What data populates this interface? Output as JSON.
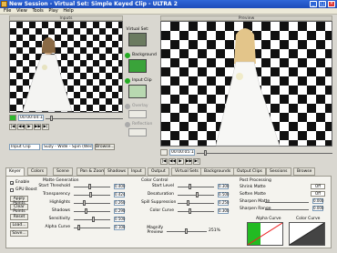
{
  "window": {
    "title": "New Session - Virtual Set: Simple Keyed Clip - ULTRA 2"
  },
  "menu": [
    "File",
    "View",
    "Tools",
    "Play",
    "Help"
  ],
  "input_panel": {
    "header": "Inputs",
    "timecode": "00:00:04:14",
    "source_select": "Input Clip",
    "clip_field": "Suzy - Wide - Spin (Wedding)...",
    "browse_label": "Browse..."
  },
  "virtual_set": {
    "header": "Virtual Set:",
    "items": [
      "Background",
      "Input Clip",
      "Overlay",
      "Reflection"
    ]
  },
  "preview_panel": {
    "header": "Preview",
    "timecode": "00:00:05:14"
  },
  "tabs": [
    "Keyer",
    "Colors",
    "Scene",
    "Pan & Zoom",
    "Shadows",
    "Input",
    "Output",
    "Virtual Sets",
    "Backgrounds",
    "Output Clips",
    "Sessions",
    "Browse"
  ],
  "keyer": {
    "enable_label": "Enable",
    "gpu_boost_label": "GPU Boost",
    "buttons": [
      "Apply Points",
      "Clear Points",
      "Reset",
      "Load...",
      "Save..."
    ],
    "matte_header": "Matte Generation",
    "matte": [
      {
        "label": "Start Threshold",
        "value": "0.400"
      },
      {
        "label": "Transparency",
        "value": "0.424"
      },
      {
        "label": "Highlights",
        "value": "0.260"
      },
      {
        "label": "Shadows",
        "value": "0.290"
      },
      {
        "label": "Sensitivity",
        "value": "0.500"
      },
      {
        "label": "Alpha Curve",
        "value": "0.100"
      }
    ],
    "color_header": "Color Control",
    "color": [
      {
        "label": "Start Level",
        "value": "0.300"
      },
      {
        "label": "Desaturation",
        "value": "0.500"
      },
      {
        "label": "Spill Suppression",
        "value": "0.250"
      },
      {
        "label": "Color Curve",
        "value": "0.300"
      }
    ],
    "magnify_label": "Magnify Preview",
    "magnify_value": "251%",
    "post_header": "Post Processing",
    "post": [
      {
        "label": "Shrink Matte",
        "value": "Off"
      },
      {
        "label": "Soften Matte",
        "value": "Off"
      },
      {
        "label": "Sharpen Matte",
        "value": "0.000"
      },
      {
        "label": "Sharpen Range",
        "value": "0.000"
      }
    ],
    "alpha_curve_label": "Alpha Curve",
    "color_curve_label": "Color Curve"
  }
}
